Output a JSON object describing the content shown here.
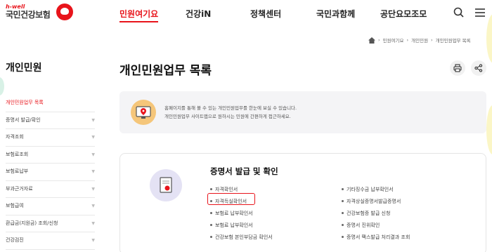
{
  "header": {
    "logo_small": "h-well",
    "logo_name": "국민건강보험",
    "nav": [
      "민원여기요",
      "건강iN",
      "정책센터",
      "국민과함께",
      "공단요모조모"
    ],
    "active_nav": "민원여기요"
  },
  "breadcrumb": [
    "민원여기요",
    "개인민원",
    "개인민원업무 목록"
  ],
  "sidebar": {
    "title": "개인민원",
    "items": [
      "개인민원업무 목록",
      "증명서 발급/확인",
      "자격조회",
      "보험료조회",
      "보험료납부",
      "부과근거자료",
      "보험급여",
      "환급금(지원금) 조회/신청",
      "건강검진"
    ]
  },
  "main": {
    "title": "개인민원업무 목록",
    "notice_lines": [
      "홈페이지를 통해 볼 수 있는 개인민원업무를 한눈에 보실 수 있습니다.",
      "개인민원업무 사이트맵으로 원하시는 민원에 간편하게 접근하세요."
    ]
  },
  "card": {
    "title": "증명서 발급 및 확인",
    "left_items": [
      "자격확인서",
      "자격득실확인서",
      "보험료 납부확인서",
      "보험료 납부확인서",
      "건강보험 본인부담금 확인서"
    ],
    "right_items": [
      "기타징수금 납부확인서",
      "자격상실증명서발급증명서",
      "건강보험증 발급 신청",
      "증명서 진위확인",
      "증명서 팩스발급 처리결과 조회"
    ],
    "highlighted_item": "자격득실확인서"
  },
  "colors": {
    "accent": "#e8141b"
  }
}
